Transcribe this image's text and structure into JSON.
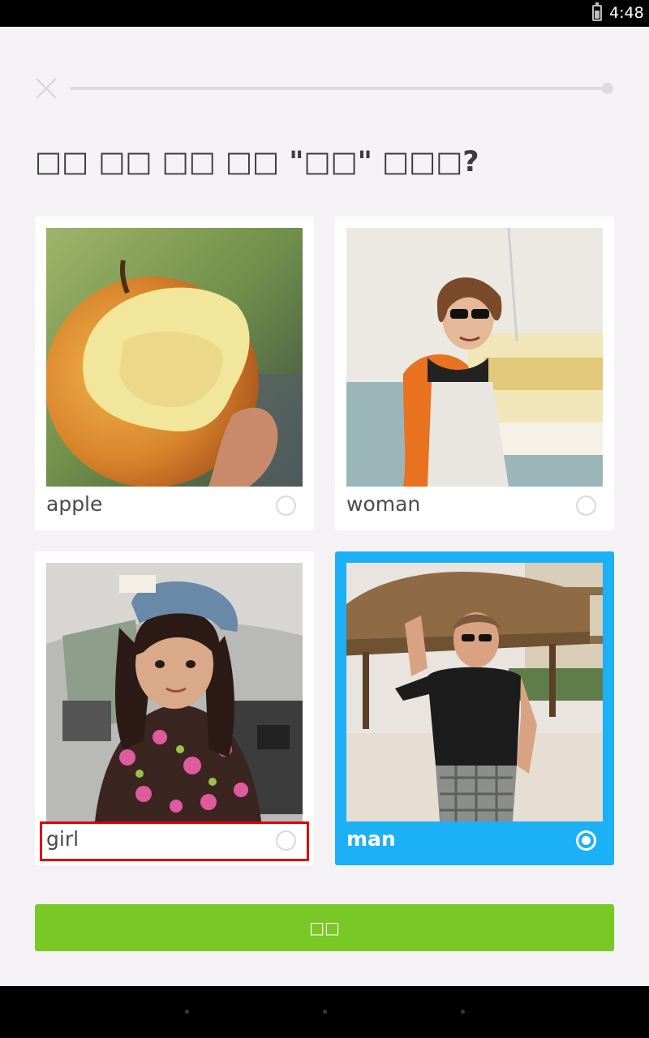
{
  "status_bar": {
    "time": "4:48"
  },
  "progress": {
    "value": 1.0
  },
  "question": "□□ □□ □□ □□ \"□□\" □□□?",
  "options": [
    {
      "label": "apple",
      "icon": "apple-photo",
      "selected": false
    },
    {
      "label": "woman",
      "icon": "woman-photo",
      "selected": false
    },
    {
      "label": "girl",
      "icon": "girl-photo",
      "selected": false
    },
    {
      "label": "man",
      "icon": "man-photo",
      "selected": true
    }
  ],
  "submit": {
    "label": "□□"
  },
  "colors": {
    "accent": "#1cb0f6",
    "submit": "#78c826",
    "highlight": "#e00000"
  }
}
